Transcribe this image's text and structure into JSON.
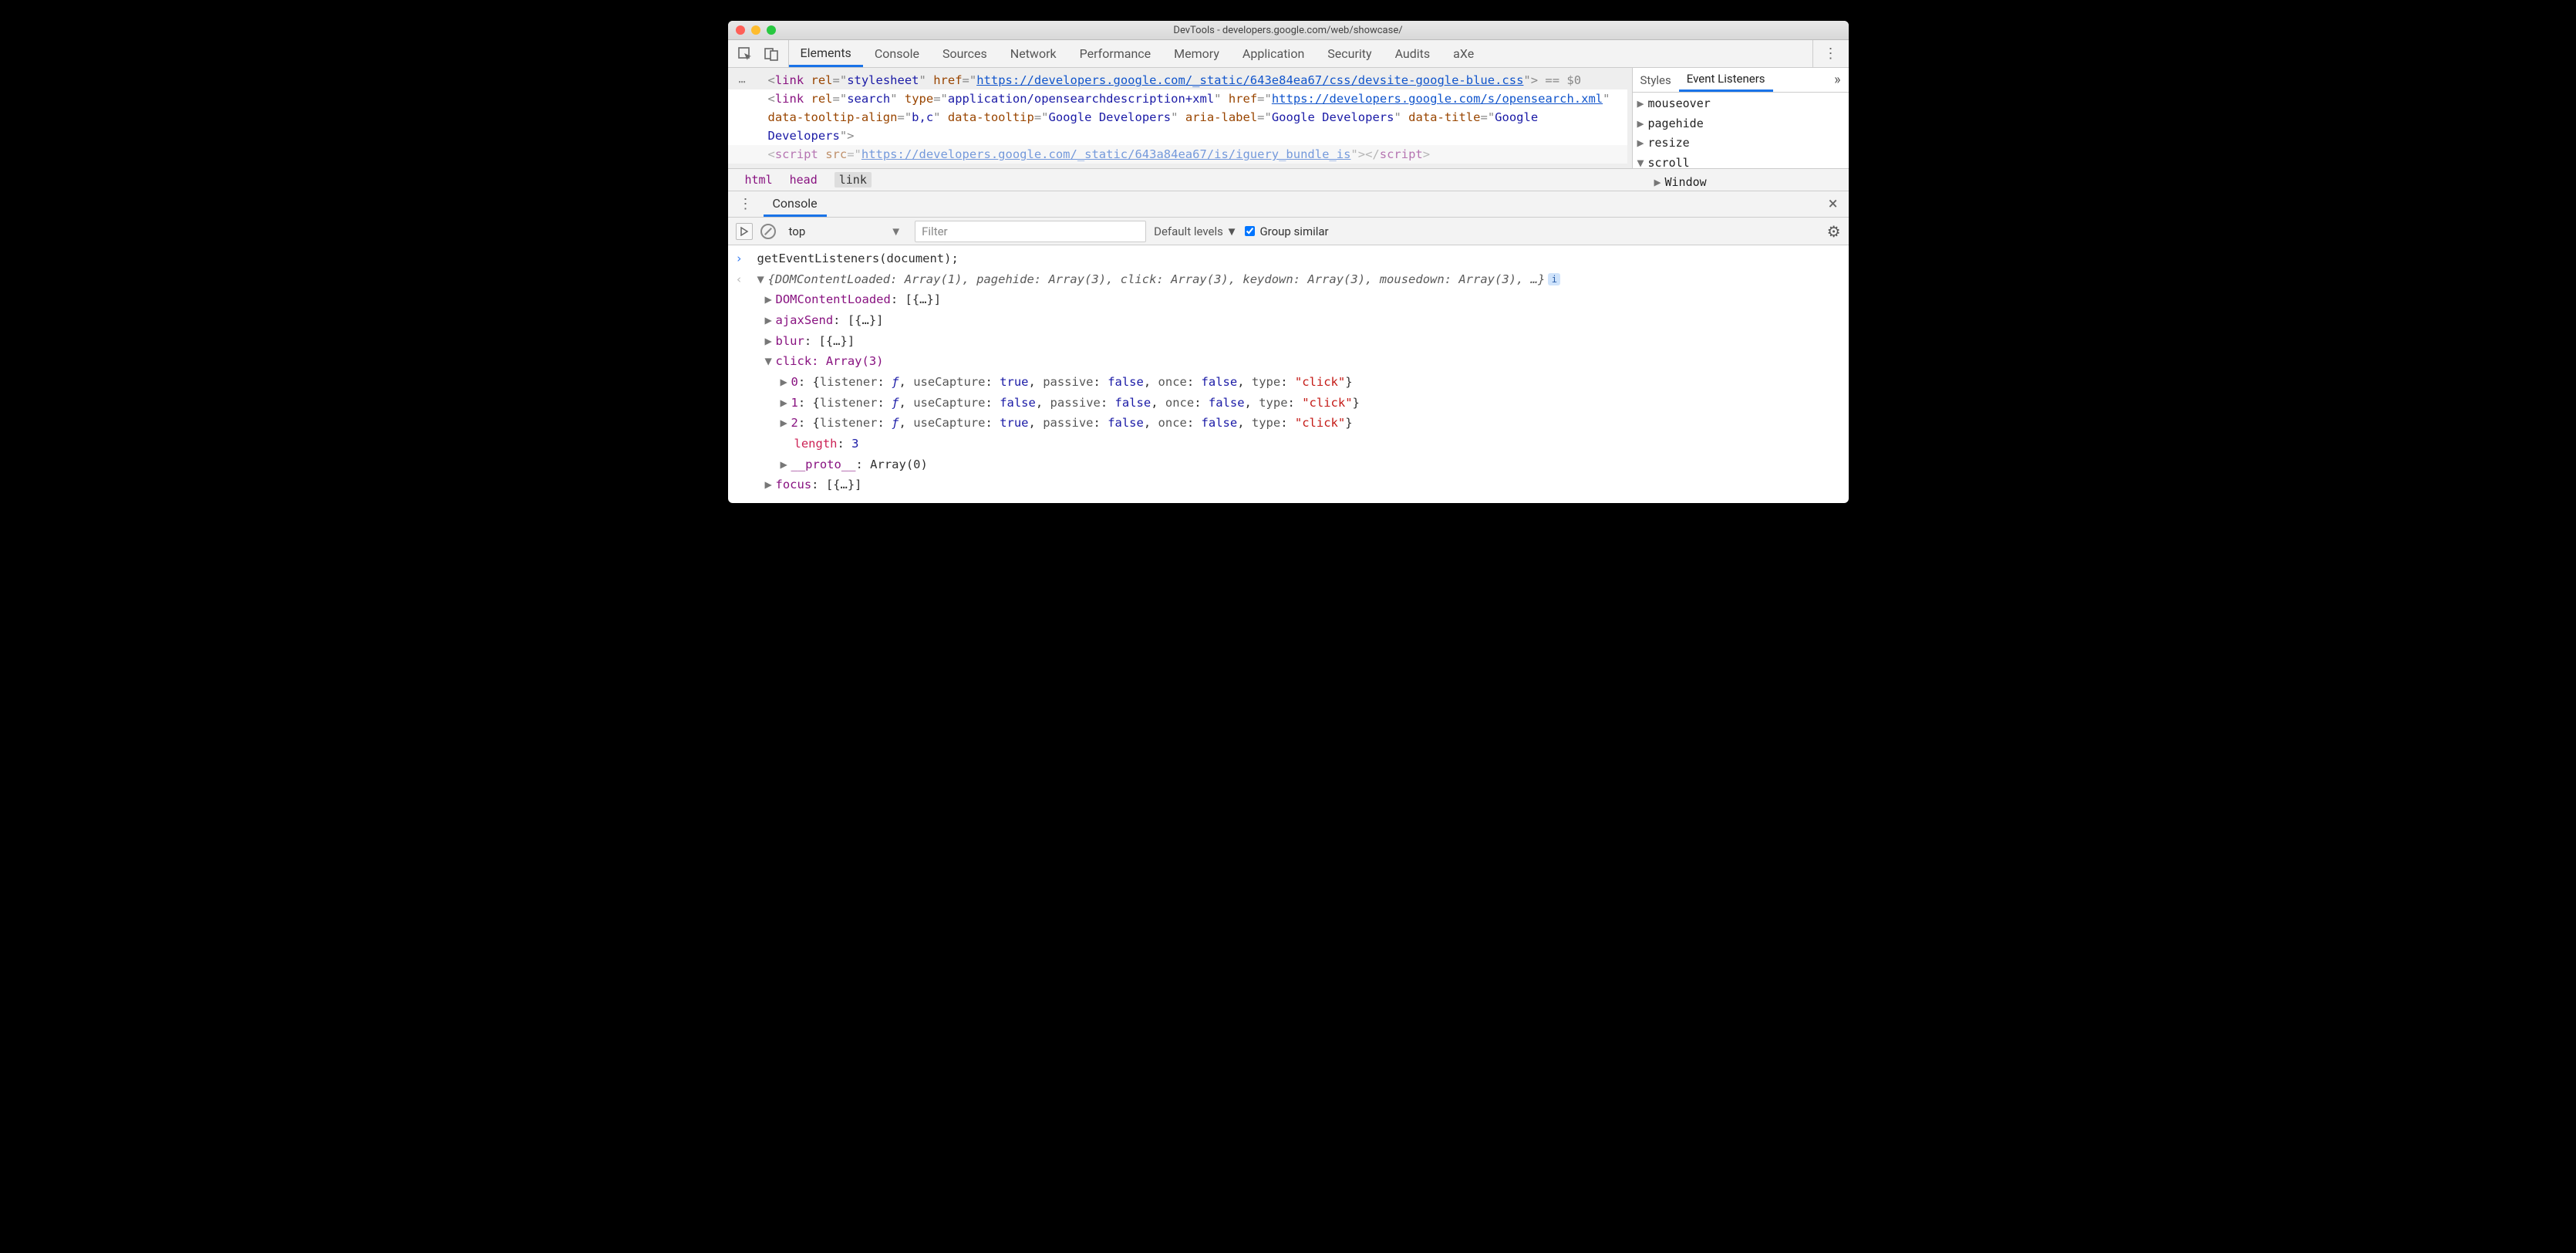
{
  "window": {
    "title": "DevTools - developers.google.com/web/showcase/"
  },
  "tabs": {
    "items": [
      "Elements",
      "Console",
      "Sources",
      "Network",
      "Performance",
      "Memory",
      "Application",
      "Security",
      "Audits",
      "aXe"
    ],
    "active": "Elements"
  },
  "elements_panel": {
    "line1_href": "https://developers.google.com/_static/643e84ea67/css/devsite-google-blue.css",
    "line1_rel": "stylesheet",
    "eq0": " == $0",
    "line2_rel": "search",
    "line2_type": "application/opensearchdescription+xml",
    "line2_href": "https://developers.google.com/s/opensearch.xml",
    "line2_dta": "b,c",
    "line2_dt": "Google Developers",
    "line2_aria": "Google Developers",
    "line2_title": "Google Developers",
    "line3_src": "https://developers.google.com/_static/643a84ea67/is/iguery_bundle_is"
  },
  "right_panel": {
    "tabs": [
      "Styles",
      "Event Listeners"
    ],
    "active": "Event Listeners",
    "events": {
      "collapsed": [
        "mouseover",
        "pagehide",
        "resize"
      ],
      "expanded": "scroll",
      "expanded_children": [
        "Window"
      ]
    }
  },
  "breadcrumb": [
    "html",
    "head",
    "link"
  ],
  "drawer": {
    "tab": "Console",
    "toolbar": {
      "context": "top",
      "filter_placeholder": "Filter",
      "levels": "Default levels",
      "group_similar": "Group similar"
    }
  },
  "console": {
    "input": "getEventListeners(document);",
    "summary": "{DOMContentLoaded: Array(1), pagehide: Array(3), click: Array(3), keydown: Array(3), mousedown: Array(3), …}",
    "rows": {
      "DOMContentLoaded": "[{…}]",
      "ajaxSend": "[{…}]",
      "blur": "[{…}]",
      "click_label": "click: Array(3)",
      "click_items": [
        {
          "idx": "0",
          "useCapture": "true",
          "passive": "false",
          "once": "false",
          "type": "\"click\""
        },
        {
          "idx": "1",
          "useCapture": "false",
          "passive": "false",
          "once": "false",
          "type": "\"click\""
        },
        {
          "idx": "2",
          "useCapture": "true",
          "passive": "false",
          "once": "false",
          "type": "\"click\""
        }
      ],
      "length_label": "length",
      "length_val": "3",
      "proto_label": "__proto__",
      "proto_val": "Array(0)",
      "focus": "[{…}]"
    }
  }
}
